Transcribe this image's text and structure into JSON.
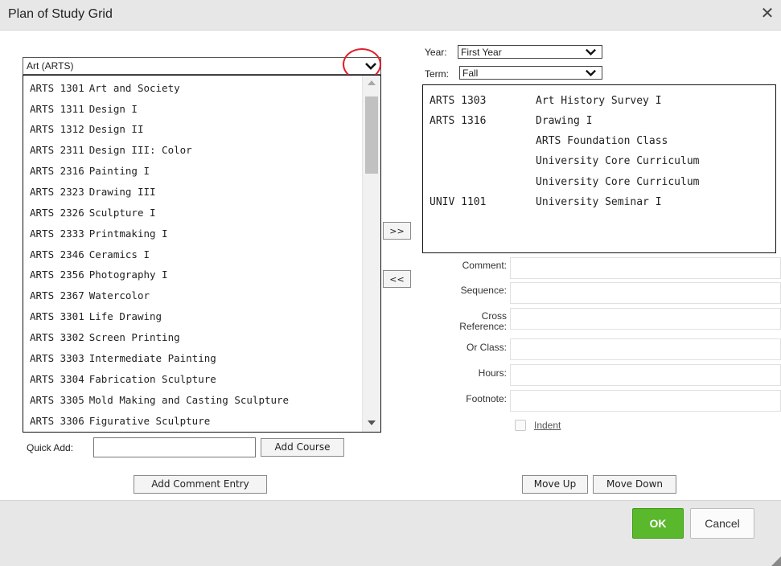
{
  "dialog": {
    "title": "Plan of Study Grid",
    "close_symbol": "✕"
  },
  "subject": {
    "selected": "Art (ARTS)",
    "circle_highlight_color": "#e0202a"
  },
  "courses": [
    {
      "code": "ARTS 1301",
      "name": "Art and Society"
    },
    {
      "code": "ARTS 1311",
      "name": "Design I"
    },
    {
      "code": "ARTS 1312",
      "name": "Design II"
    },
    {
      "code": "ARTS 2311",
      "name": "Design III: Color"
    },
    {
      "code": "ARTS 2316",
      "name": "Painting I"
    },
    {
      "code": "ARTS 2323",
      "name": "Drawing III"
    },
    {
      "code": "ARTS 2326",
      "name": "Sculpture I"
    },
    {
      "code": "ARTS 2333",
      "name": "Printmaking I"
    },
    {
      "code": "ARTS 2346",
      "name": "Ceramics I"
    },
    {
      "code": "ARTS 2356",
      "name": "Photography I"
    },
    {
      "code": "ARTS 2367",
      "name": "Watercolor"
    },
    {
      "code": "ARTS 3301",
      "name": "Life Drawing"
    },
    {
      "code": "ARTS 3302",
      "name": "Screen Printing"
    },
    {
      "code": "ARTS 3303",
      "name": "Intermediate Painting"
    },
    {
      "code": "ARTS 3304",
      "name": "Fabrication Sculpture"
    },
    {
      "code": "ARTS 3305",
      "name": "Mold Making and Casting Sculpture"
    },
    {
      "code": "ARTS 3306",
      "name": "Figurative Sculpture"
    }
  ],
  "quick_add": {
    "label": "Quick Add:",
    "value": "",
    "button": "Add Course"
  },
  "add_comment_button": "Add Comment Entry",
  "move_buttons": {
    "add": ">>",
    "remove": "<<"
  },
  "year": {
    "label": "Year:",
    "selected": "First Year"
  },
  "term": {
    "label": "Term:",
    "selected": "Fall"
  },
  "plan": [
    {
      "code": "ARTS 1303",
      "name": "Art History Survey I"
    },
    {
      "code": "ARTS 1316",
      "name": "Drawing I"
    },
    {
      "code": "",
      "name": "ARTS Foundation Class"
    },
    {
      "code": "",
      "name": "University Core Curriculum"
    },
    {
      "code": "",
      "name": "University Core Curriculum"
    },
    {
      "code": "UNIV 1101",
      "name": "University Seminar I"
    }
  ],
  "fields": {
    "comment": "Comment:",
    "sequence": "Sequence:",
    "cross_reference_1": "Cross",
    "cross_reference_2": "Reference:",
    "or_class": "Or Class:",
    "hours": "Hours:",
    "footnote": "Footnote:",
    "indent": "Indent"
  },
  "order_buttons": {
    "up": "Move Up",
    "down": "Move Down"
  },
  "footer": {
    "ok": "OK",
    "cancel": "Cancel",
    "ok_color": "#59b82b"
  }
}
